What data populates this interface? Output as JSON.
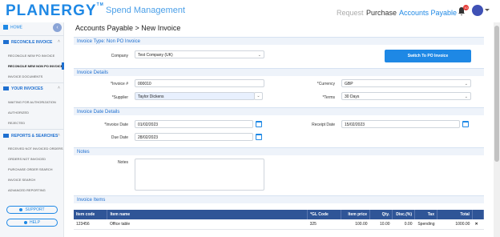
{
  "brand": {
    "name": "PLANERGY",
    "tm": "TM",
    "subtitle": "Spend Management"
  },
  "topnav": {
    "request": "Request",
    "purchase": "Purchase",
    "accounts_payable": "Accounts Payable",
    "notification_count": "10"
  },
  "sidebar": {
    "home": "HOME",
    "sections": [
      {
        "title": "RECONCILE INVOICE",
        "items": [
          "RECONCILE NEW PO INVOICE",
          "RECONCILE NEW NON PO INVOICE",
          "INVOICE DOCUMENTS"
        ],
        "active_index": 1
      },
      {
        "title": "YOUR INVOICES",
        "items": [
          "WAITING FOR AUTHORIZATION",
          "AUTHORIZED",
          "REJECTED"
        ]
      },
      {
        "title": "REPORTS & SEARCHES",
        "items": [
          "RECEIVED NOT INVOICED ORDERS",
          "ORDERS NOT INVOICED",
          "PURCHASE ORDER SEARCH",
          "INVOICE SEARCH",
          "ADVANCED REPORTING"
        ]
      }
    ],
    "support": "SUPPORT",
    "help": "HELP"
  },
  "page": {
    "breadcrumb": "Accounts Payable > New Invoice"
  },
  "invoice_type": {
    "header": "Invoice Type: Non PO Invoice",
    "company_label": "Company",
    "company_value": "Test Company (UK)",
    "switch_button": "Switch To PO Invoice"
  },
  "invoice_details": {
    "header": "Invoice Details",
    "invoice_no_label": "*Invoice #",
    "invoice_no_value": "000010",
    "supplier_label": "*Supplier",
    "supplier_value": "Taylor Dickens",
    "currency_label": "*Currency",
    "currency_value": "GBP",
    "terms_label": "*Terms",
    "terms_value": "30 Days"
  },
  "invoice_dates": {
    "header": "Invoice Date Details",
    "invoice_date_label": "*Invoice Date",
    "invoice_date_value": "01/02/2023",
    "receipt_date_label": "Receipt Date",
    "receipt_date_value": "15/02/2023",
    "due_date_label": "Due Date",
    "due_date_value": "28/02/2023"
  },
  "notes": {
    "header": "Notes",
    "label": "Notes"
  },
  "items": {
    "header": "Invoice Items",
    "columns": [
      "Item code",
      "Item name",
      "*GL Code",
      "Item price",
      "Qty.",
      "Disc.(%)",
      "Tax",
      "Total"
    ],
    "rows": [
      {
        "code": "123456",
        "name": "Office table",
        "gl": "325",
        "price": "100.00",
        "qty": "10.00",
        "disc": "0.00",
        "tax": "Spending",
        "total": "1000.00"
      }
    ]
  }
}
